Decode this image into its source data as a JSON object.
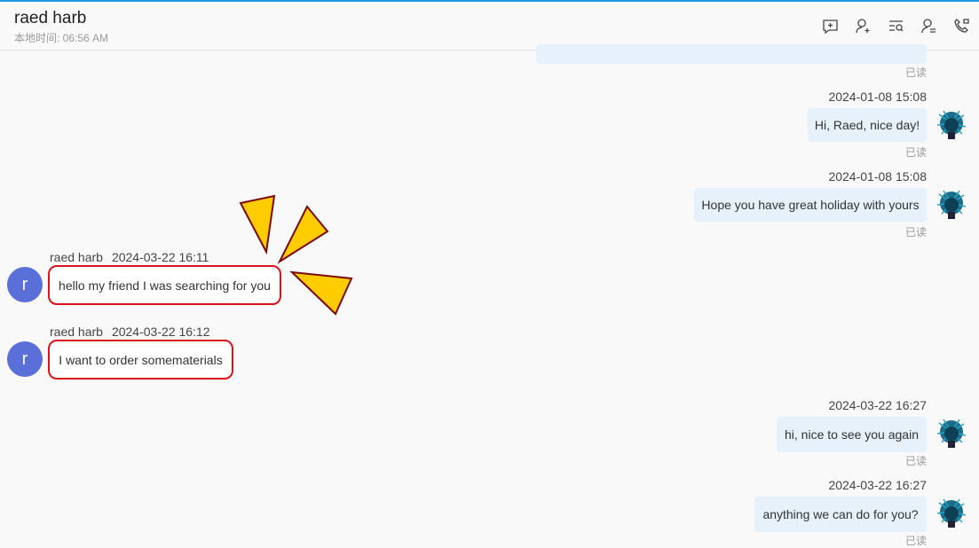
{
  "header": {
    "title": "raed harb",
    "local_time": "本地时间: 06:56 AM",
    "icons": [
      "add-chat-icon",
      "add-user-icon",
      "search-messages-icon",
      "transfer-user-icon",
      "call-icon"
    ]
  },
  "read_label": "已读",
  "messages_right": [
    {
      "time": "2024-01-08 15:08",
      "text": "Hi, Raed, nice day!"
    },
    {
      "time": "2024-01-08 15:08",
      "text": "Hope you have great holiday with yours"
    },
    {
      "time": "2024-03-22 16:27",
      "text": "hi, nice to see you again"
    },
    {
      "time": "2024-03-22 16:27",
      "text": "anything we can do for you?"
    }
  ],
  "messages_left": [
    {
      "sender": "raed harb",
      "time": "2024-03-22 16:11",
      "text": "hello my friend I was searching for you",
      "avatar": "r"
    },
    {
      "sender": "raed harb",
      "time": "2024-03-22 16:12",
      "text": "I want to order somematerials",
      "avatar": "r"
    }
  ],
  "colors": {
    "accent": "#1e9be0",
    "highlight": "#d9141a",
    "avatar": "#5a6fd8",
    "bubble": "#e6f1fc",
    "burst": "#ffcc00"
  }
}
